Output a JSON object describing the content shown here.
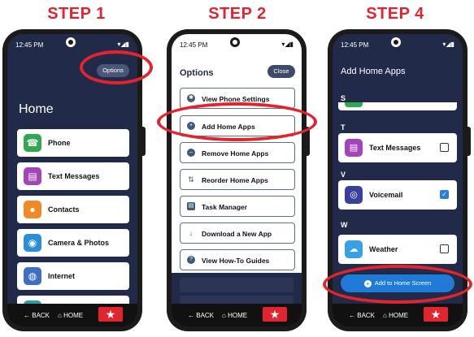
{
  "steps": {
    "s1": "STEP 1",
    "s2": "STEP 2",
    "s3": "STEP 4"
  },
  "status": {
    "time": "12:45 PM",
    "signal": "▾◢▮"
  },
  "nav": {
    "back": "BACK",
    "home": "HOME",
    "star": "★"
  },
  "screen1": {
    "options_label": "Options",
    "title": "Home",
    "apps": [
      {
        "label": "Phone",
        "icon": "phone-icon",
        "color": "#2fa84f",
        "glyph": "☎"
      },
      {
        "label": "Text Messages",
        "icon": "text-messages-icon",
        "color": "#a344b8",
        "glyph": "▤"
      },
      {
        "label": "Contacts",
        "icon": "contacts-icon",
        "color": "#f08a24",
        "glyph": "●"
      },
      {
        "label": "Camera & Photos",
        "icon": "camera-icon",
        "color": "#2a8fd8",
        "glyph": "◉"
      },
      {
        "label": "Internet",
        "icon": "internet-icon",
        "color": "#3d6fc4",
        "glyph": "◍"
      }
    ]
  },
  "screen2": {
    "header": "Options",
    "close_label": "Close",
    "items": [
      {
        "label": "View Phone Settings",
        "glyph": "✱"
      },
      {
        "label": "Add Home Apps",
        "glyph": "+"
      },
      {
        "label": "Remove Home Apps",
        "glyph": "–"
      },
      {
        "label": "Reorder Home Apps",
        "glyph": "⇅"
      },
      {
        "label": "Task Manager",
        "glyph": "▤"
      },
      {
        "label": "Download a New App",
        "glyph": "↓"
      },
      {
        "label": "View How-To Guides",
        "glyph": "?"
      }
    ]
  },
  "screen3": {
    "title": "Add Home Apps",
    "sections": {
      "s": "S",
      "t": "T",
      "v": "V",
      "w": "W"
    },
    "apps": [
      {
        "label": "Text Messages",
        "icon": "text-messages-icon",
        "color": "#a344b8",
        "glyph": "▤",
        "checked": false
      },
      {
        "label": "Voicemail",
        "icon": "voicemail-icon",
        "color": "#3b3f9c",
        "glyph": "◎",
        "checked": true
      },
      {
        "label": "Weather",
        "icon": "weather-icon",
        "color": "#3aa0e6",
        "glyph": "☁",
        "checked": false
      }
    ],
    "add_button": "Add to Home Screen"
  },
  "colors": {
    "step_red": "#e1242e",
    "dark_bg": "#222a4a",
    "button_blue": "#1f7bd6"
  }
}
